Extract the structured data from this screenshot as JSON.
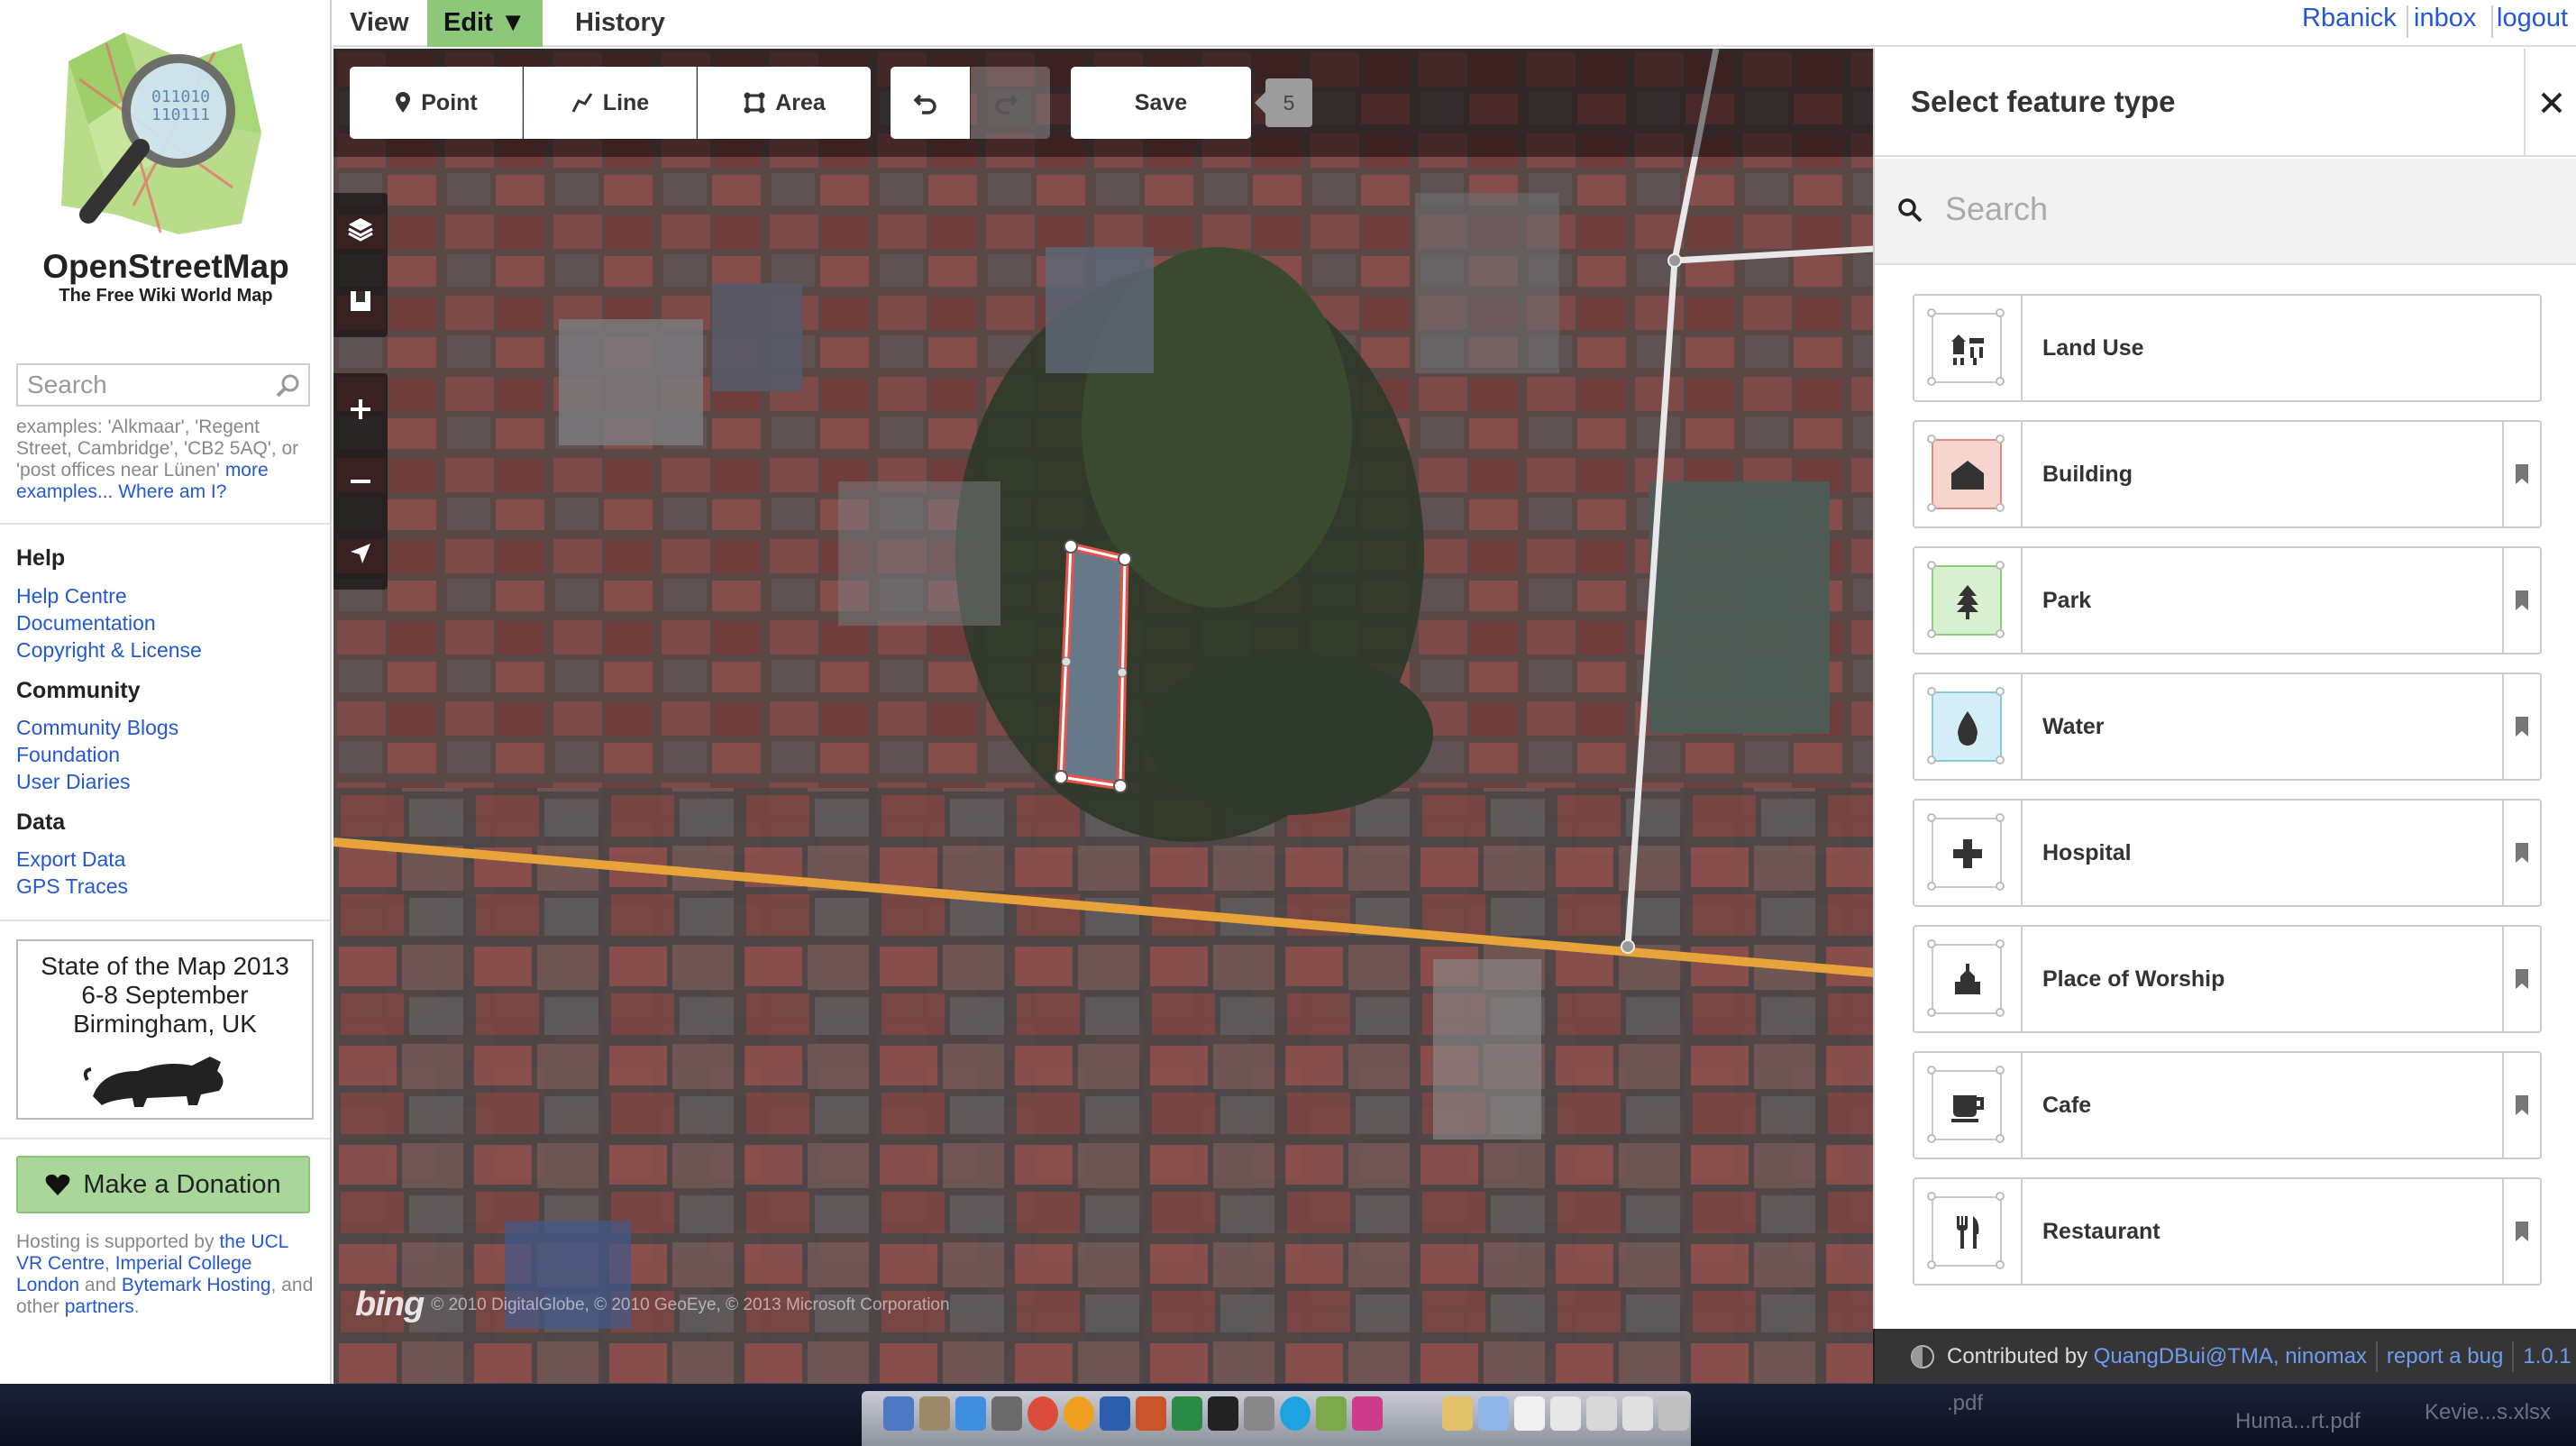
{
  "sidebar": {
    "brand_title": "OpenStreetMap",
    "brand_subtitle": "The Free Wiki World Map",
    "search_placeholder": "Search",
    "examples_prefix": "examples: 'Alkmaar', 'Regent Street, Cambridge', 'CB2 5AQ', or 'post offices near Lünen'",
    "examples_more": "more examples...",
    "where_am_i": "Where am I?",
    "help_heading": "Help",
    "help_links": [
      "Help Centre",
      "Documentation",
      "Copyright & License"
    ],
    "community_heading": "Community",
    "community_links": [
      "Community Blogs",
      "Foundation",
      "User Diaries"
    ],
    "data_heading": "Data",
    "data_links": [
      "Export Data",
      "GPS Traces"
    ],
    "sotm_line1": "State of the Map 2013",
    "sotm_line2": "6-8 September",
    "sotm_line3": "Birmingham, UK",
    "donate_label": "Make a Donation",
    "hosting_prefix": "Hosting is supported by",
    "hosting_link1": "the UCL VR Centre",
    "hosting_link2": "Imperial College London",
    "hosting_and": "and",
    "hosting_link3": "Bytemark Hosting",
    "hosting_suffix": ", and other",
    "hosting_link4": "partners"
  },
  "topnav": {
    "view": "View",
    "edit": "Edit ▼",
    "history": "History",
    "user": "Rbanick",
    "inbox": "inbox",
    "logout": "logout"
  },
  "toolbar": {
    "point": "Point",
    "line": "Line",
    "area": "Area",
    "save": "Save",
    "save_count": "5"
  },
  "map": {
    "attribution": "© 2010 DigitalGlobe, © 2010 GeoEye, © 2013 Microsoft Corporation",
    "bing_logo": "bing",
    "colors": {
      "road_major": "#e8a33a",
      "road_minor": "#e8e8e8",
      "selected_outline": "#e5534b"
    }
  },
  "panel": {
    "title": "Select feature type",
    "search_placeholder": "Search",
    "presets": [
      {
        "label": "Land Use",
        "icon": "landuse-icon",
        "color": "#ffffff"
      },
      {
        "label": "Building",
        "icon": "building-icon",
        "color": "#f6d5cf"
      },
      {
        "label": "Park",
        "icon": "tree-icon",
        "color": "#d8f0cf"
      },
      {
        "label": "Water",
        "icon": "water-drop-icon",
        "color": "#d3eef6"
      },
      {
        "label": "Hospital",
        "icon": "hospital-cross-icon",
        "color": "#ffffff"
      },
      {
        "label": "Place of Worship",
        "icon": "worship-icon",
        "color": "#ffffff"
      },
      {
        "label": "Cafe",
        "icon": "cafe-cup-icon",
        "color": "#ffffff"
      },
      {
        "label": "Restaurant",
        "icon": "restaurant-icon",
        "color": "#ffffff"
      }
    ]
  },
  "footer": {
    "contributed_by": "Contributed by",
    "contributors": "QuangDBui@TMA, ninomax",
    "report_bug": "report a bug",
    "version": "1.0.1"
  },
  "dock": {
    "label1": "Huma...rt.pdf",
    "label2": "Kevie...s.xlsx",
    "label3": ".pdf"
  }
}
